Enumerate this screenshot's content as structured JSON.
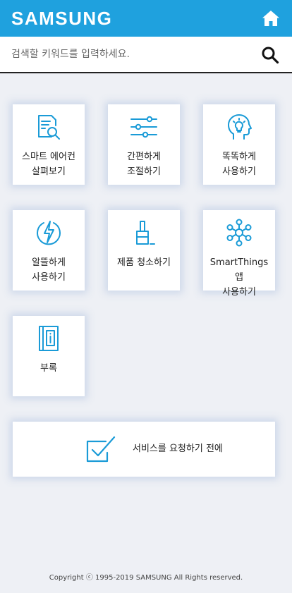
{
  "header": {
    "logo": "SAMSUNG",
    "home_icon": "home-icon"
  },
  "search": {
    "placeholder": "검색할 키워드를 입력하세요.",
    "value": "",
    "search_icon": "search-icon"
  },
  "menu": [
    {
      "label": "스마트 에어컨\n살펴보기",
      "icon": "document-search-icon"
    },
    {
      "label": "간편하게\n조절하기",
      "icon": "sliders-icon"
    },
    {
      "label": "똑똑하게\n사용하기",
      "icon": "head-lightbulb-icon"
    },
    {
      "label": "알뜰하게\n사용하기",
      "icon": "lightning-circle-icon"
    },
    {
      "label": "제품 청소하기",
      "icon": "paint-brush-icon"
    },
    {
      "label": "SmartThings 앱\n사용하기",
      "icon": "network-hub-icon"
    },
    {
      "label": "부록",
      "icon": "book-info-icon"
    }
  ],
  "service": {
    "label": "서비스를 요청하기 전에",
    "icon": "checkbox-check-icon"
  },
  "footer": {
    "copyright": "Copyright ⓒ 1995-2019 SAMSUNG All Rights reserved."
  },
  "colors": {
    "brand_blue": "#1fa1de",
    "icon_blue": "#1a9bd7",
    "background": "#eef0f5"
  }
}
